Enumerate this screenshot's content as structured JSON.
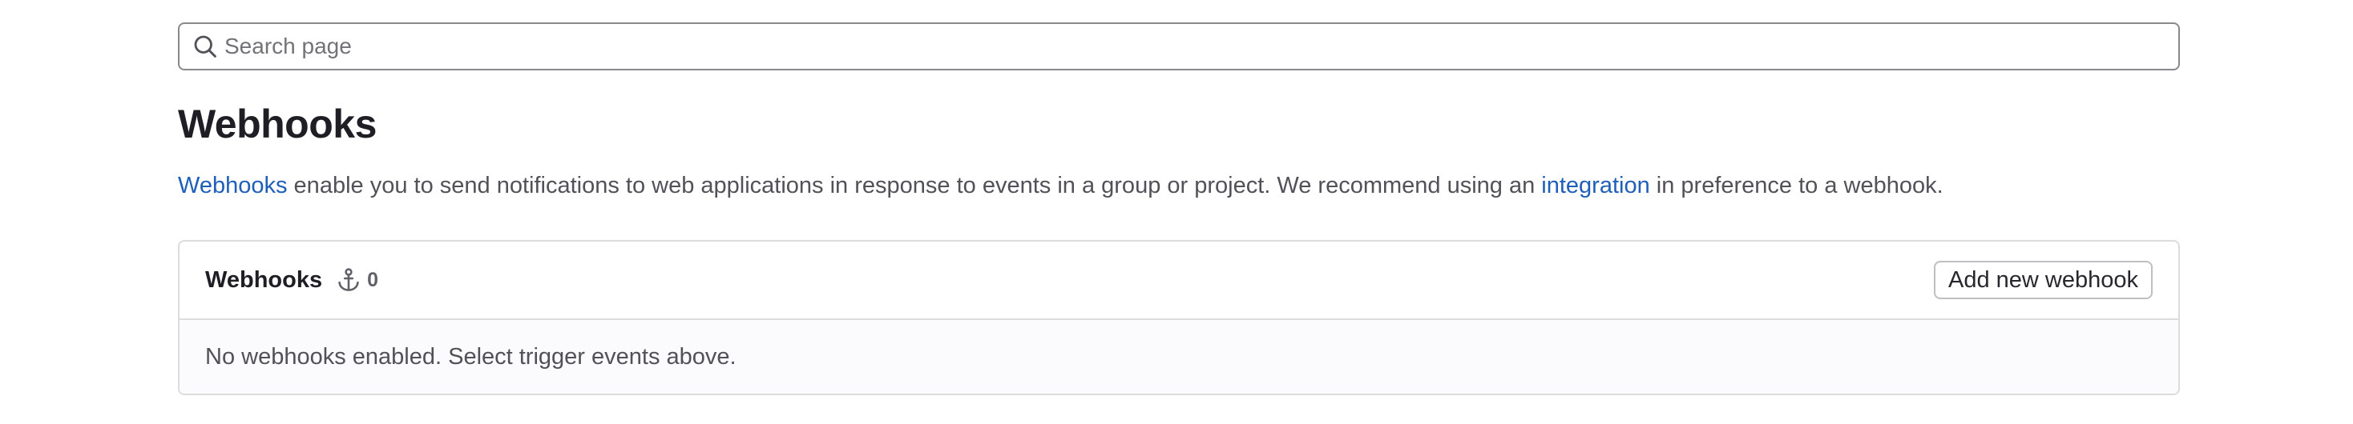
{
  "search": {
    "placeholder": "Search page",
    "value": "",
    "icon": "search-icon"
  },
  "page": {
    "title": "Webhooks",
    "description": {
      "link1": "Webhooks",
      "text1": " enable you to send notifications to web applications in response to events in a group or project. We recommend using an ",
      "link2": "integration",
      "text2": " in preference to a webhook."
    }
  },
  "card": {
    "title": "Webhooks",
    "count_icon": "anchor-icon",
    "count": "0",
    "add_button_label": "Add new webhook",
    "empty_message": "No webhooks enabled. Select trigger events above."
  },
  "colors": {
    "link": "#1f5fb8",
    "title": "#1f1e24",
    "text": "#535158",
    "border": "#dcdcde",
    "body_bg": "#fbfafd"
  }
}
